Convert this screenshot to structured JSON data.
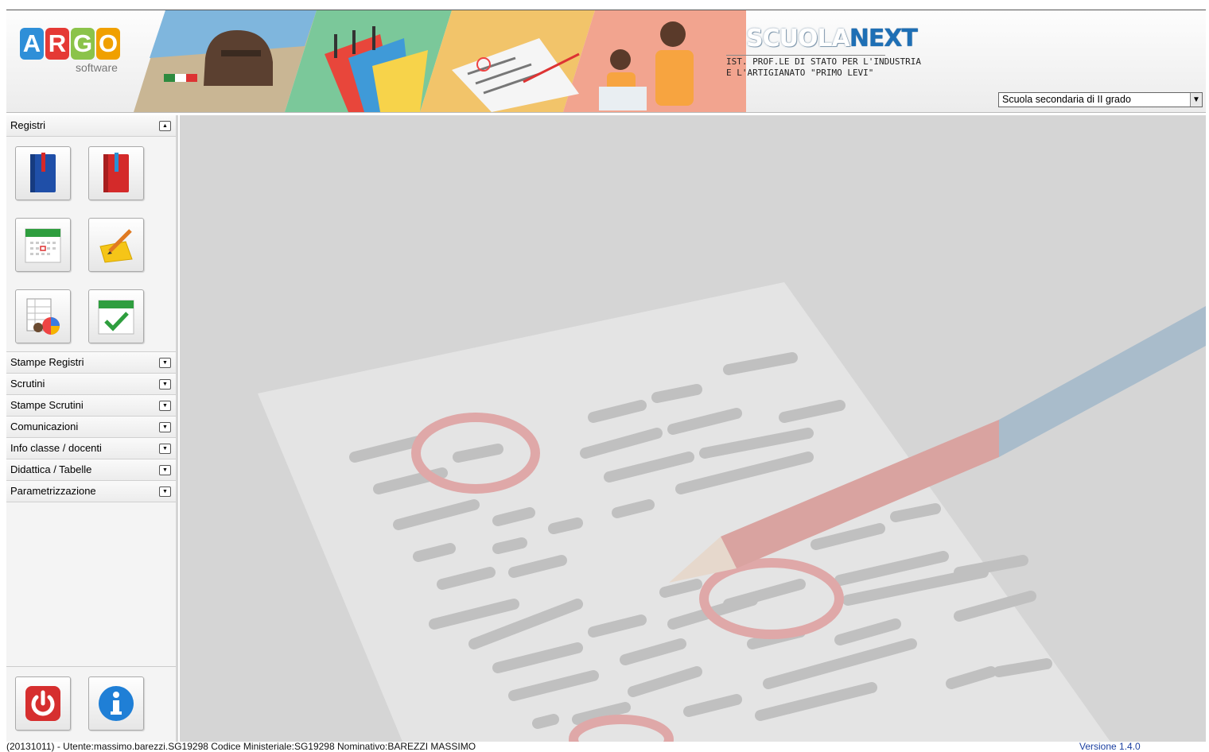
{
  "header": {
    "logo_letters": [
      "A",
      "R",
      "G",
      "O"
    ],
    "logo_colors": [
      "#2f8fd8",
      "#e53935",
      "#8bc34a",
      "#f0a000"
    ],
    "logo_sub": "software",
    "product_part1": "SCUOLA",
    "product_part2": "NEXT",
    "school_name": "IST. PROF.LE DI STATO PER L'INDUSTRIA E L'ARTIGIANATO \"PRIMO LEVI\"",
    "school_type_selected": "Scuola secondaria di II grado"
  },
  "sidebar": {
    "sections": [
      {
        "label": "Registri",
        "expanded": true
      },
      {
        "label": "Stampe Registri"
      },
      {
        "label": "Scrutini"
      },
      {
        "label": "Stampe Scrutini"
      },
      {
        "label": "Comunicazioni"
      },
      {
        "label": "Info classe / docenti"
      },
      {
        "label": "Didattica / Tabelle"
      },
      {
        "label": "Parametrizzazione"
      }
    ],
    "registri_icons": [
      "registro-docente-icon",
      "registro-classe-icon",
      "calendar-icon",
      "notes-pencil-icon",
      "report-chart-icon",
      "calendar-check-icon"
    ],
    "bottom_icons": [
      "power-icon",
      "info-icon"
    ]
  },
  "status": {
    "text": "(20131011) - Utente:massimo.barezzi.SG19298 Codice Ministeriale:SG19298 Nominativo:BAREZZI MASSIMO",
    "version": "Versione 1.4.0"
  }
}
